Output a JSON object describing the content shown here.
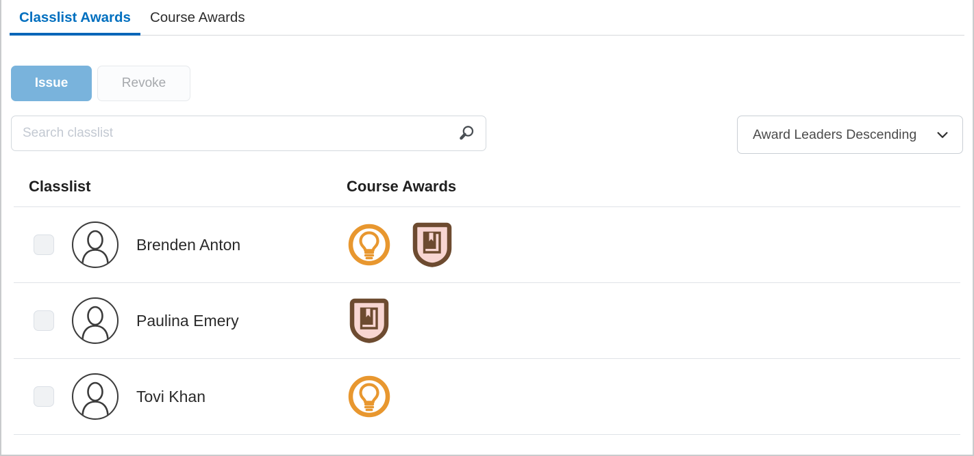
{
  "tabs": [
    {
      "label": "Classlist Awards",
      "active": true
    },
    {
      "label": "Course Awards",
      "active": false
    }
  ],
  "actions": {
    "issue_label": "Issue",
    "revoke_label": "Revoke"
  },
  "search": {
    "placeholder": "Search classlist",
    "value": "",
    "icon": "search-icon"
  },
  "sort": {
    "selected": "Award Leaders Descending",
    "icon": "chevron-down-icon",
    "options": [
      "Award Leaders Descending"
    ]
  },
  "table": {
    "headers": {
      "classlist": "Classlist",
      "awards": "Course Awards"
    },
    "rows": [
      {
        "checked": false,
        "avatar": "user-avatar-icon",
        "name": "Brenden Anton",
        "awards": [
          "lightbulb-award-icon",
          "book-shield-award-icon"
        ]
      },
      {
        "checked": false,
        "avatar": "user-avatar-icon",
        "name": "Paulina Emery",
        "awards": [
          "book-shield-award-icon"
        ]
      },
      {
        "checked": false,
        "avatar": "user-avatar-icon",
        "name": "Tovi Khan",
        "awards": [
          "lightbulb-award-icon"
        ]
      }
    ]
  },
  "colors": {
    "active_tab": "#006fbf",
    "tab_underline": "#0966b8",
    "primary_button": "#79b3dc",
    "award_orange": "#e8972f",
    "award_brown": "#6d4b30",
    "award_pink": "#f8d6d2"
  }
}
